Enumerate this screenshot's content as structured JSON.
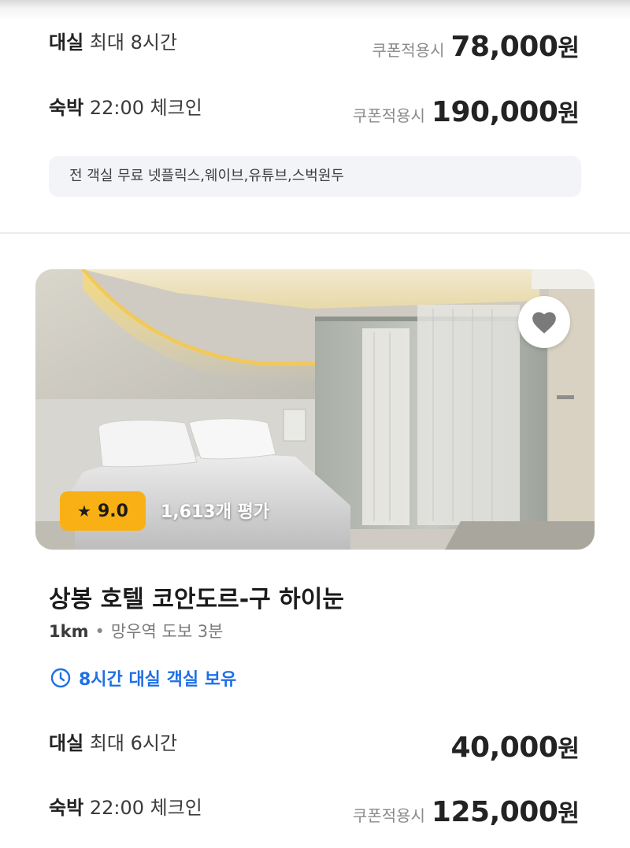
{
  "prev_listing": {
    "rows": [
      {
        "label_strong": "대실",
        "label_rest": "최대 8시간",
        "coupon": "쿠폰적용시",
        "price": "78,000",
        "unit": "원"
      },
      {
        "label_strong": "숙박",
        "label_rest": "22:00 체크인",
        "coupon": "쿠폰적용시",
        "price": "190,000",
        "unit": "원"
      }
    ],
    "notice": "전 객실 무료 넷플릭스,웨이브,유튜브,스벅원두"
  },
  "listing": {
    "photo_icon": "hotel-room-photo",
    "favorite_icon": "heart-icon",
    "rating": "9.0",
    "rating_icon": "star-icon",
    "review_count": "1,613개 평가",
    "name": "상봉 호텔 코안도르-구 하이눈",
    "distance": "1km",
    "separator": "•",
    "station": "망우역 도보 3분",
    "tag_icon": "clock-icon",
    "tag": "8시간 대실 객실 보유",
    "rows": [
      {
        "label_strong": "대실",
        "label_rest": "최대 6시간",
        "coupon": "",
        "price": "40,000",
        "unit": "원"
      },
      {
        "label_strong": "숙박",
        "label_rest": "22:00 체크인",
        "coupon": "쿠폰적용시",
        "price": "125,000",
        "unit": "원"
      }
    ]
  },
  "colors": {
    "accent_blue": "#1f6fe5",
    "rating_badge": "#f9b014",
    "notice_bg": "#f2f4f7"
  }
}
